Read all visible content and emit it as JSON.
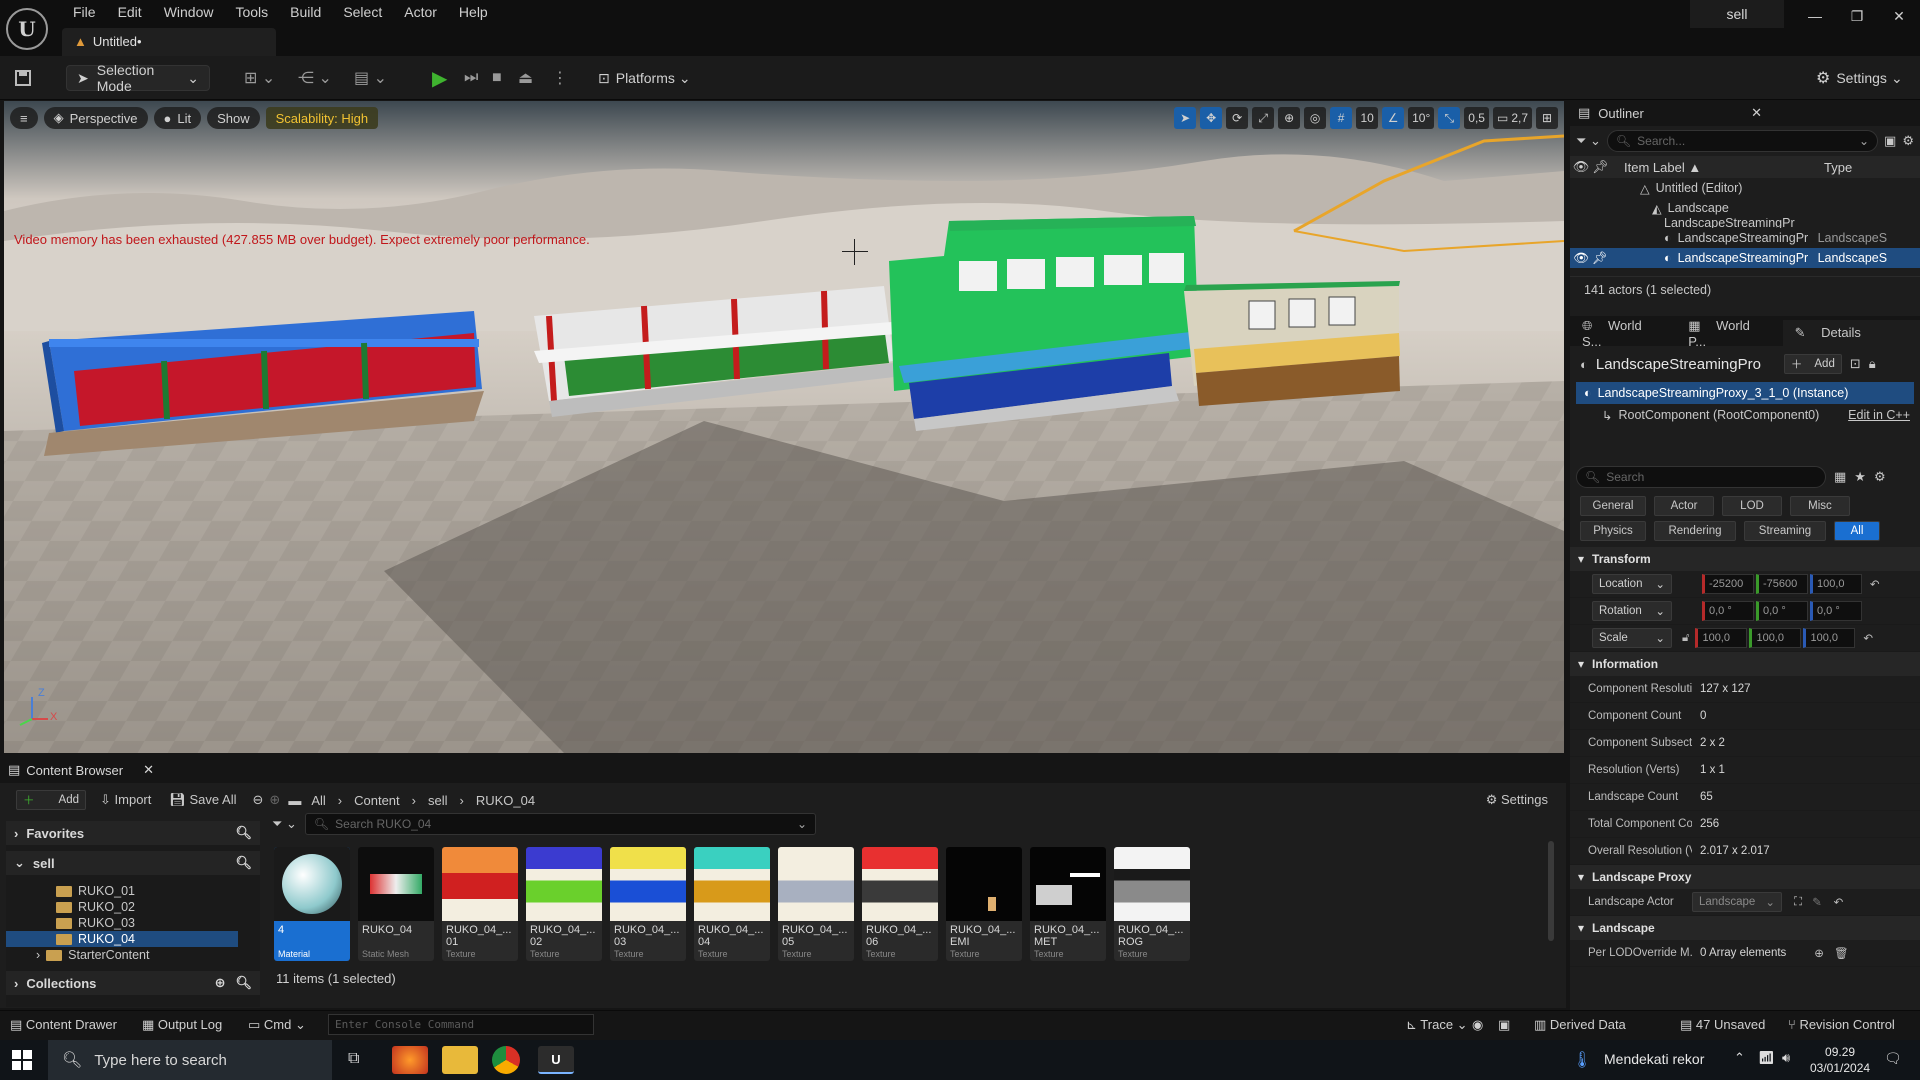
{
  "app": {
    "menus": [
      "File",
      "Edit",
      "Window",
      "Tools",
      "Build",
      "Select",
      "Actor",
      "Help"
    ],
    "doc_tab": "Untitled•",
    "project": "sell"
  },
  "toolbar": {
    "selection_mode": "Selection Mode",
    "platforms": "Platforms",
    "settings": "Settings"
  },
  "viewport": {
    "perspective": "Perspective",
    "lit": "Lit",
    "show": "Show",
    "scalability": "Scalability: High",
    "grid_snap": "10",
    "rotation_snap": "10°",
    "scale_snap": "0,5",
    "camera_speed": "2,7",
    "warning": "Video memory has been exhausted (427.855 MB over budget). Expect extremely poor performance.",
    "axis_z": "Z",
    "axis_x": "X"
  },
  "outliner": {
    "title": "Outliner",
    "search_placeholder": "Search...",
    "col_label": "Item Label ▲",
    "col_type": "Type",
    "rows": [
      {
        "label": "Untitled (Editor)",
        "type": ""
      },
      {
        "label": "Landscape",
        "type": ""
      },
      {
        "label": "LandscapeStreamingPr",
        "type": "LandscapeS"
      },
      {
        "label": "LandscapeStreamingPr",
        "type": "LandscapeS"
      },
      {
        "label": "LandscapeStreamingPr",
        "type": "LandscapeS"
      }
    ],
    "status": "141 actors (1 selected)"
  },
  "details": {
    "tabs": [
      "World S...",
      "World P...",
      "Details"
    ],
    "actor_name": "LandscapeStreamingPro",
    "add_label": "Add",
    "instance": "LandscapeStreamingProxy_3_1_0 (Instance)",
    "root_component": "RootComponent (RootComponent0)",
    "edit_cpp": "Edit in C++",
    "search_placeholder": "Search",
    "categories_row1": [
      "General",
      "Actor",
      "LOD",
      "Misc"
    ],
    "categories_row2": [
      "Physics",
      "Rendering",
      "Streaming",
      "All"
    ],
    "transform_title": "Transform",
    "location_label": "Location",
    "rotation_label": "Rotation",
    "scale_label": "Scale",
    "location": [
      "-25200",
      "-75600",
      "100,0"
    ],
    "rotation": [
      "0,0 °",
      "0,0 °",
      "0,0 °"
    ],
    "scale": [
      "100,0",
      "100,0",
      "100,0"
    ],
    "information_title": "Information",
    "info": [
      {
        "label": "Component Resolutio",
        "value": "127 x 127"
      },
      {
        "label": "Component Count",
        "value": "0"
      },
      {
        "label": "Component Subsectic",
        "value": "2 x 2"
      },
      {
        "label": "Resolution (Verts)",
        "value": "1 x 1"
      },
      {
        "label": "Landscape Count",
        "value": "65"
      },
      {
        "label": "Total Component Cou",
        "value": "256"
      },
      {
        "label": "Overall Resolution (V",
        "value": "2.017 x 2.017"
      }
    ],
    "proxy_title": "Landscape Proxy",
    "landscape_actor_label": "Landscape Actor",
    "landscape_actor_value": "Landscape",
    "landscape_title": "Landscape",
    "lod_override_label": "Per LODOverride M...",
    "lod_override_value": "0 Array elements"
  },
  "content_browser": {
    "title": "Content Browser",
    "add": "Add",
    "import": "Import",
    "save_all": "Save All",
    "path": [
      "All",
      "Content",
      "sell",
      "RUKO_04"
    ],
    "settings": "Settings",
    "search_placeholder": "Search RUKO_04",
    "favorites": "Favorites",
    "root": "sell",
    "folders": [
      "RUKO_01",
      "RUKO_02",
      "RUKO_03",
      "RUKO_04",
      "StarterContent"
    ],
    "collections": "Collections",
    "status": "11 items (1 selected)",
    "assets": [
      {
        "name": "4",
        "type": "Material"
      },
      {
        "name": "RUKO_04",
        "type": "Static Mesh"
      },
      {
        "name": "RUKO_04_... 01",
        "type": "Texture"
      },
      {
        "name": "RUKO_04_... 02",
        "type": "Texture"
      },
      {
        "name": "RUKO_04_... 03",
        "type": "Texture"
      },
      {
        "name": "RUKO_04_... 04",
        "type": "Texture"
      },
      {
        "name": "RUKO_04_... 05",
        "type": "Texture"
      },
      {
        "name": "RUKO_04_... 06",
        "type": "Texture"
      },
      {
        "name": "RUKO_04_... EMI",
        "type": "Texture"
      },
      {
        "name": "RUKO_04_... MET",
        "type": "Texture"
      },
      {
        "name": "RUKO_04_... ROG",
        "type": "Texture"
      }
    ]
  },
  "statusbar": {
    "content_drawer": "Content Drawer",
    "output_log": "Output Log",
    "cmd": "Cmd",
    "console_placeholder": "Enter Console Command",
    "trace": "Trace",
    "derived_data": "Derived Data",
    "unsaved": "47 Unsaved",
    "revision_control": "Revision Control"
  },
  "taskbar": {
    "search_placeholder": "Type here to search",
    "news": "Mendekati rekor",
    "time": "09.29",
    "date": "03/01/2024"
  }
}
